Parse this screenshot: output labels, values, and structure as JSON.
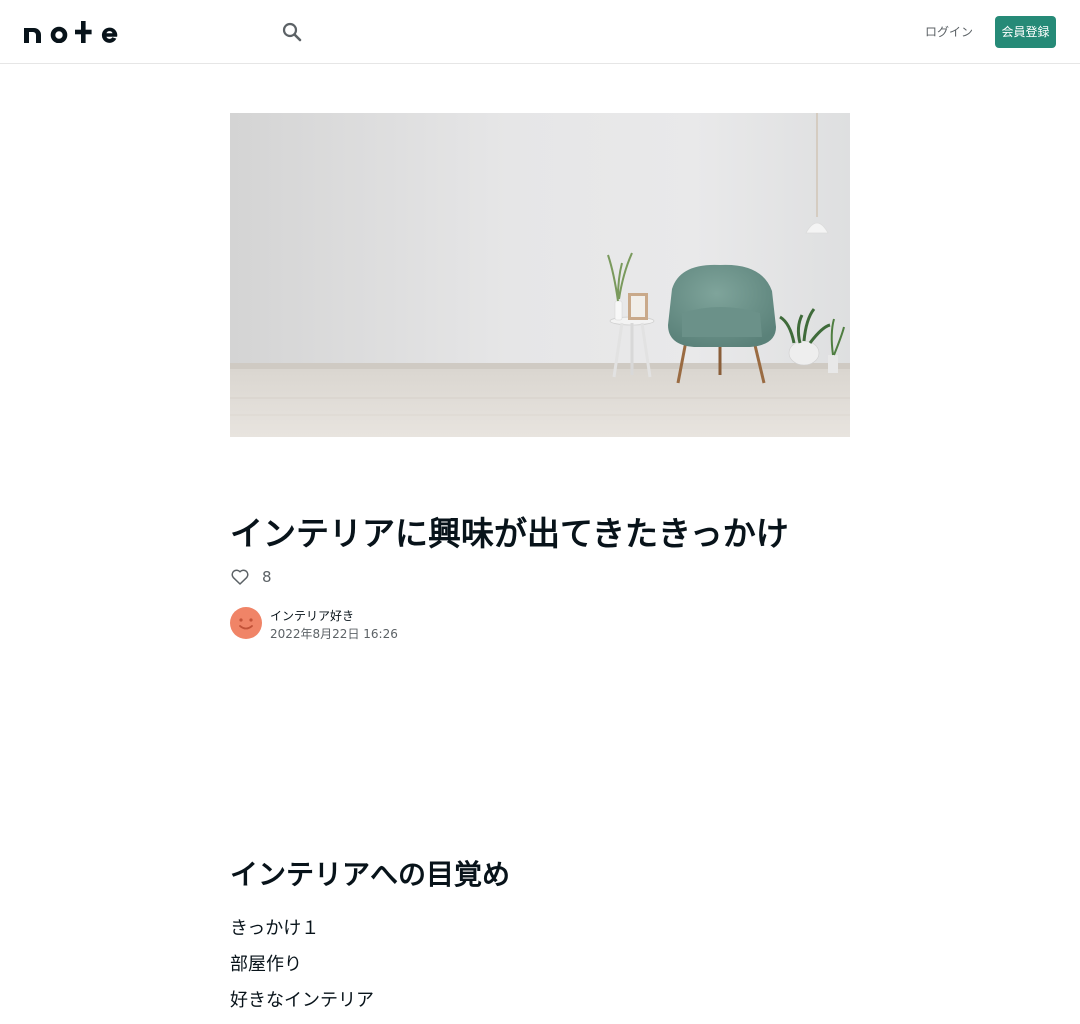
{
  "header": {
    "logo_text": "note",
    "search_icon": "search-icon",
    "login_label": "ログイン",
    "signup_label": "会員登録",
    "accent_color": "#268a77"
  },
  "article": {
    "title": "インテリアに興味が出てきたきっかけ",
    "likes": {
      "icon": "heart-outline-icon",
      "count": "8"
    },
    "author": {
      "name": "インテリア好き",
      "date": "2022年8月22日 16:26"
    },
    "section_heading": "インテリアへの目覚め",
    "list_items": [
      "きっかけ１",
      "部屋作り",
      "好きなインテリア"
    ]
  }
}
